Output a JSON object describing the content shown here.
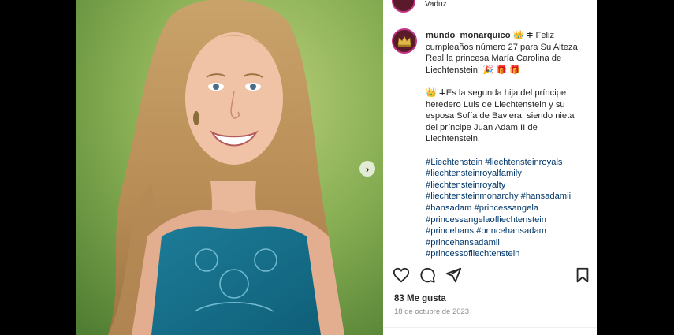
{
  "header": {
    "location": "Vaduz"
  },
  "post": {
    "username": "mundo_monarquico",
    "caption_line1": " 👑 ⵐ Feliz cumpleaños número 27 para Su Alteza Real la princesa María Carolina de Liechtenstein! 🎉 🎁 🎁",
    "caption_para2": "👑 ⵐEs la segunda hija del príncipe heredero Luis de Liechtenstein y su esposa Sofía de Baviera, siendo nieta del príncipe Juan Adam II de Liechtenstein.",
    "hashtags": [
      "#Liechtenstein",
      "#liechtensteinroyals",
      "#liechtensteinroyalfamily",
      "#liechtensteinroyalty",
      "#liechtensteinmonarchy",
      "#hansadamii",
      "#hansadam",
      "#princessangela",
      "#princessangelaofliechtenstein",
      "#princehans",
      "#princehansadam",
      "#princehansadamii",
      "#princessofliechtenstein"
    ],
    "likes": "83 Me gusta",
    "date": "18 de octubre de 2023"
  },
  "icons": {
    "like": "heart-icon",
    "comment": "comment-icon",
    "share": "share-icon",
    "save": "bookmark-icon",
    "next": "chevron-right-icon"
  },
  "colors": {
    "link": "#00376b",
    "text": "#262626",
    "muted": "#8e8e8e",
    "avatar_ring": "#c13584"
  }
}
